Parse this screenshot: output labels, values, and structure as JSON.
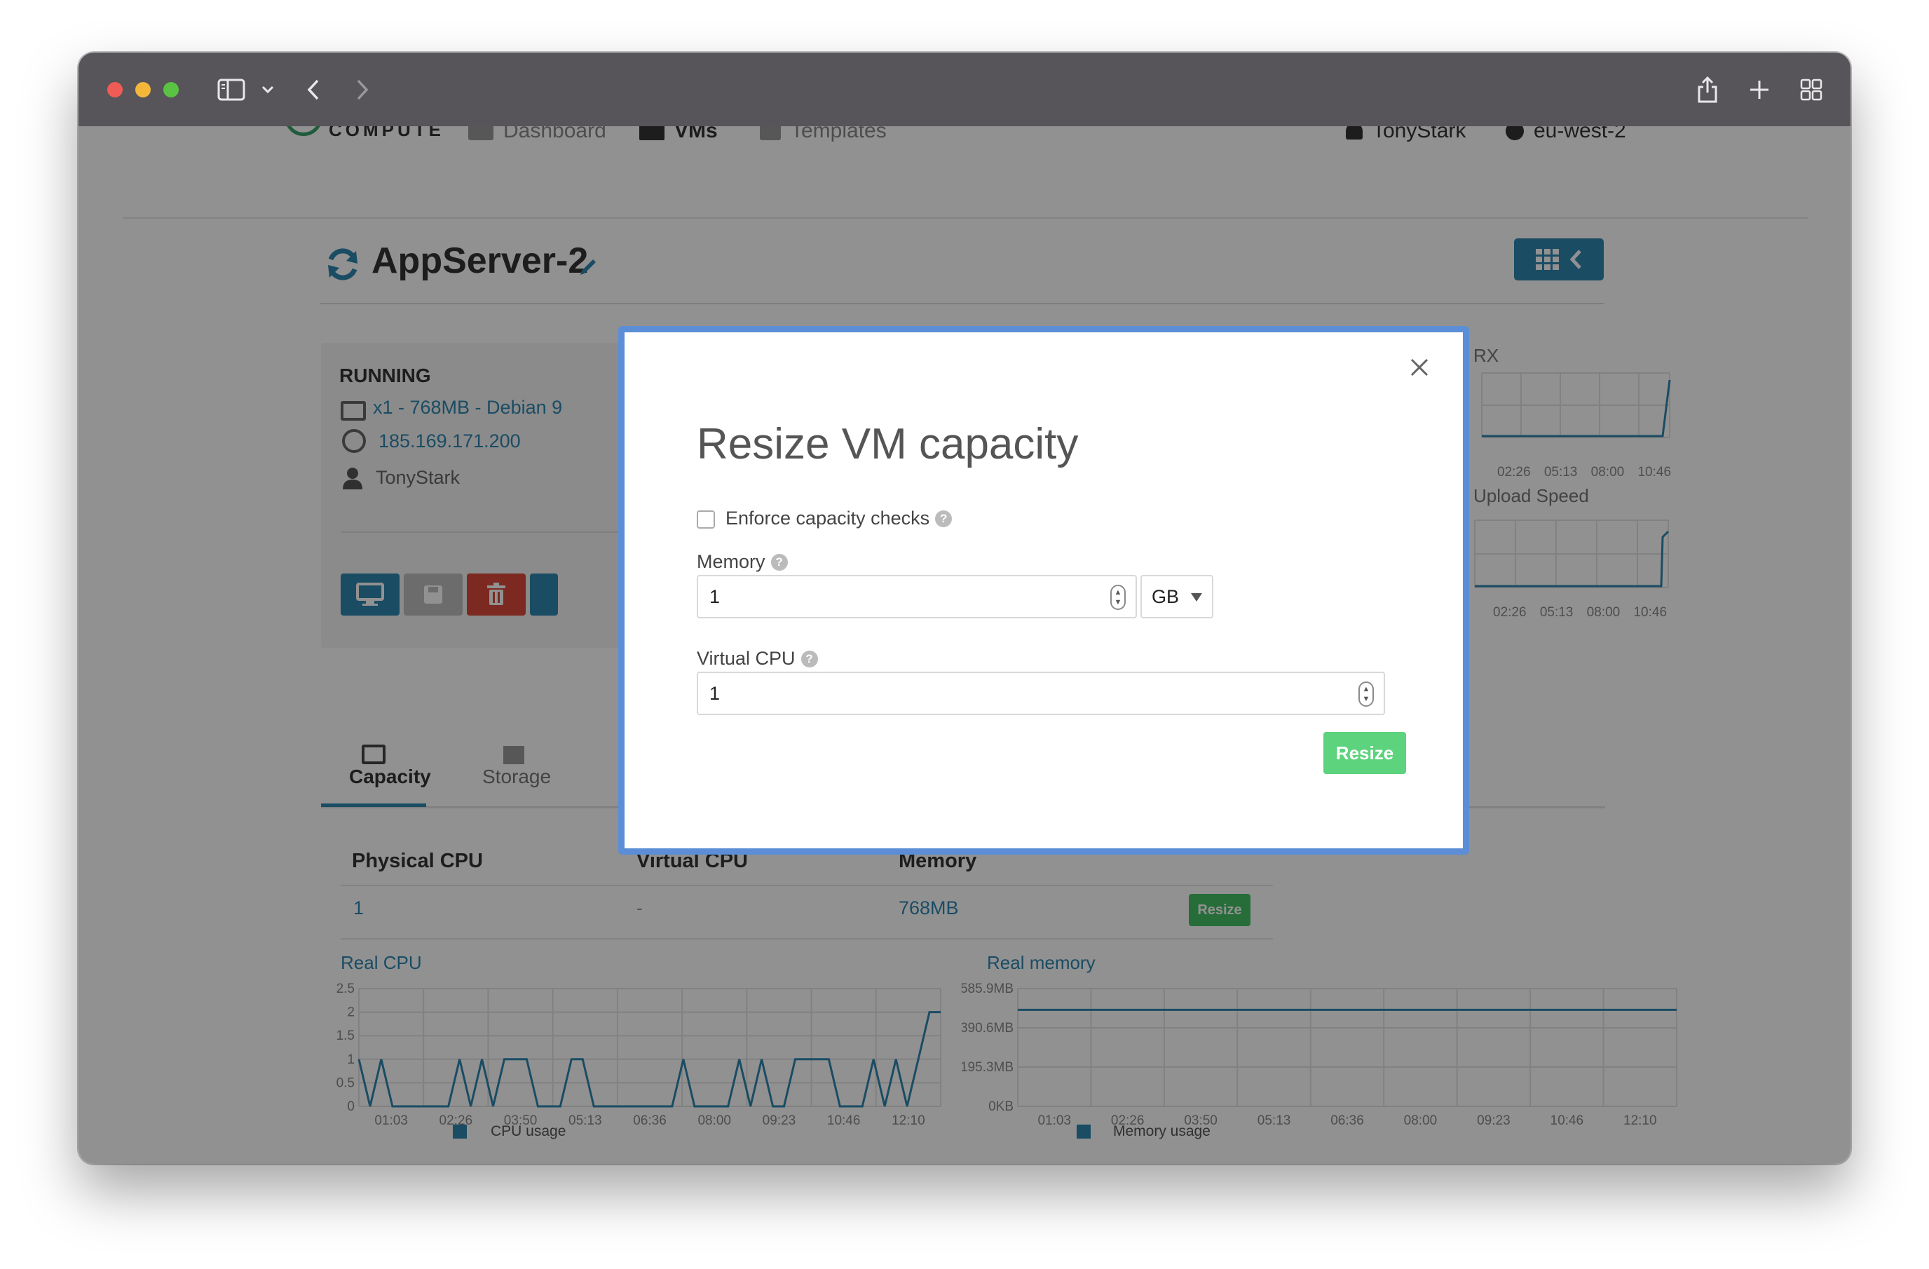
{
  "nav": {
    "logo_sub": "COMPUTE",
    "dashboard": "Dashboard",
    "vms": "VMs",
    "templates": "Templates",
    "user": "TonyStark",
    "region": "eu-west-2"
  },
  "vm": {
    "name": "AppServer-2",
    "status": "RUNNING",
    "spec": "x1 - 768MB - Debian 9",
    "ip": "185.169.171.200",
    "owner": "TonyStark"
  },
  "tabs": [
    {
      "label": "Capacity",
      "active": true
    },
    {
      "label": "Storage",
      "active": false
    }
  ],
  "capacity_table": {
    "headers": [
      "Physical CPU",
      "Virtual CPU",
      "Memory"
    ],
    "row": {
      "physical_cpu": "1",
      "virtual_cpu": "-",
      "memory": "768MB",
      "action": "Resize"
    }
  },
  "charts": {
    "rx": {
      "title": "RX",
      "x_ticks": [
        "02:26",
        "05:13",
        "08:00",
        "10:46"
      ]
    },
    "upload": {
      "title": "Upload Speed",
      "x_ticks": [
        "02:26",
        "05:13",
        "08:00",
        "10:46"
      ]
    },
    "real_cpu": {
      "title": "Real CPU",
      "y_ticks": [
        "2.5",
        "2",
        "1.5",
        "1",
        "0.5",
        "0"
      ],
      "x_ticks": [
        "01:03",
        "02:26",
        "03:50",
        "05:13",
        "06:36",
        "08:00",
        "09:23",
        "10:46",
        "12:10"
      ],
      "legend": "CPU usage"
    },
    "real_memory": {
      "title": "Real memory",
      "y_ticks": [
        "585.9MB",
        "390.6MB",
        "195.3MB",
        "0KB"
      ],
      "x_ticks": [
        "01:03",
        "02:26",
        "03:50",
        "05:13",
        "06:36",
        "08:00",
        "09:23",
        "10:46",
        "12:10"
      ],
      "legend": "Memory usage"
    }
  },
  "chart_data": [
    {
      "type": "line",
      "title": "Real CPU",
      "ylim": [
        0,
        2.5
      ],
      "series": [
        {
          "name": "CPU usage",
          "values": [
            1,
            0,
            1,
            0,
            0,
            0,
            0,
            0,
            0,
            1,
            0,
            1,
            0,
            1,
            1,
            1,
            0,
            0,
            0,
            1,
            1,
            0,
            0,
            0,
            0,
            0,
            0,
            0,
            0,
            1,
            0,
            0,
            0,
            0,
            1,
            0,
            1,
            0,
            0,
            1,
            1,
            1,
            1,
            0,
            0,
            0,
            1,
            0,
            1,
            0,
            1,
            2,
            2
          ]
        }
      ]
    },
    {
      "type": "line",
      "title": "Real memory",
      "ylim": [
        0,
        585.9
      ],
      "series": [
        {
          "name": "Memory usage",
          "values": [
            480,
            480,
            480,
            480,
            480,
            480,
            480,
            480,
            480
          ]
        }
      ]
    }
  ],
  "modal": {
    "title": "Resize VM capacity",
    "enforce_label": "Enforce capacity checks",
    "enforce_checked": false,
    "memory_label": "Memory",
    "memory_value": "1",
    "memory_unit": "GB",
    "vcpu_label": "Virtual CPU",
    "vcpu_value": "1",
    "submit_label": "Resize"
  },
  "colors": {
    "accent": "#2f87b0",
    "danger": "#d9493a",
    "success": "#5cd37c",
    "modal_border": "#5b8ed6"
  }
}
